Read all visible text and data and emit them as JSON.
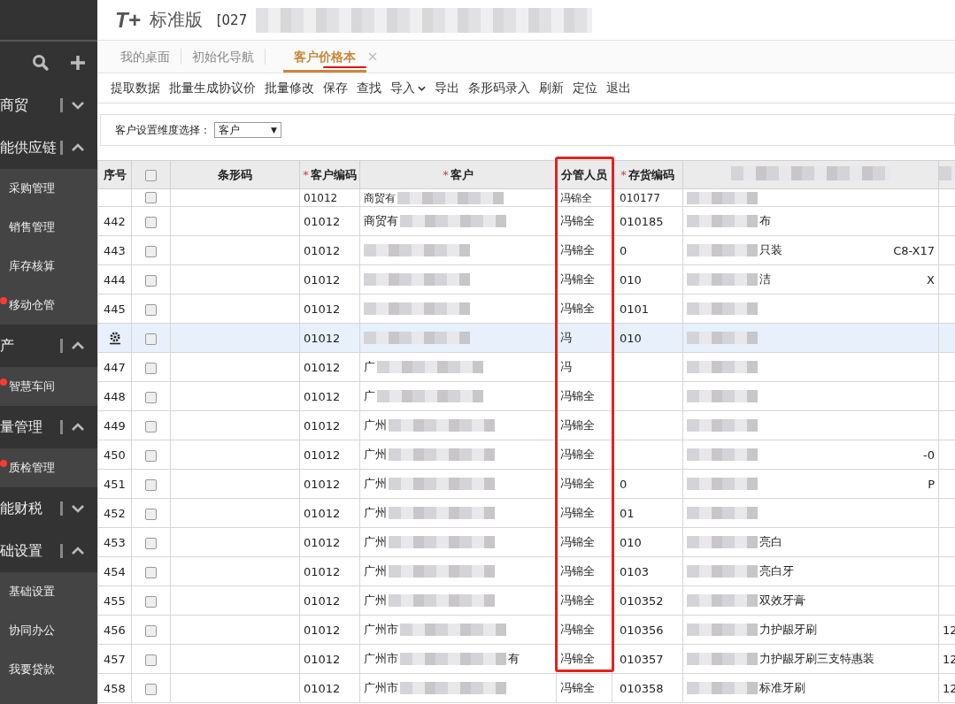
{
  "header": {
    "logo": "T+",
    "product": "标准版",
    "account": "[027"
  },
  "sidebar": {
    "groups": [
      {
        "label": "商贸",
        "expanded": false
      },
      {
        "label": "能供应链",
        "expanded": true,
        "items": [
          {
            "label": "采购管理",
            "alert": false
          },
          {
            "label": "销售管理",
            "alert": false
          },
          {
            "label": "库存核算",
            "alert": false
          },
          {
            "label": "移动仓管",
            "alert": true
          }
        ]
      },
      {
        "label": "产",
        "expanded": true,
        "items": [
          {
            "label": "智慧车间",
            "alert": true
          }
        ]
      },
      {
        "label": "量管理",
        "expanded": true,
        "items": [
          {
            "label": "质检管理",
            "alert": true
          }
        ]
      },
      {
        "label": "能财税",
        "expanded": false
      },
      {
        "label": "础设置",
        "expanded": true,
        "items": [
          {
            "label": "基础设置",
            "alert": false
          },
          {
            "label": "协同办公",
            "alert": false
          },
          {
            "label": "我要贷款",
            "alert": false
          }
        ]
      }
    ]
  },
  "tabs": [
    {
      "label": "我的桌面",
      "selected": false,
      "closable": false,
      "marked": false
    },
    {
      "label": "初始化导航",
      "selected": false,
      "closable": false,
      "marked": false
    },
    {
      "label": "客户价格本",
      "selected": true,
      "closable": true,
      "marked": true
    }
  ],
  "toolbar": [
    {
      "label": "提取数据",
      "kind": "button"
    },
    {
      "label": "批量生成协议价",
      "kind": "button"
    },
    {
      "label": "批量修改",
      "kind": "button"
    },
    {
      "label": "保存",
      "kind": "button"
    },
    {
      "label": "查找",
      "kind": "button"
    },
    {
      "label": "导入",
      "kind": "dropdown"
    },
    {
      "label": "导出",
      "kind": "button"
    },
    {
      "label": "条形码录入",
      "kind": "button"
    },
    {
      "label": "刷新",
      "kind": "button"
    },
    {
      "label": "定位",
      "kind": "button"
    },
    {
      "label": "退出",
      "kind": "button"
    }
  ],
  "filter": {
    "label": "客户设置维度选择：",
    "value": "客户",
    "arrow": "▼"
  },
  "table": {
    "header_checked": false,
    "columns": [
      {
        "label": "序号",
        "kind": "text",
        "highlighted": false
      },
      {
        "kind": "checkbox",
        "highlighted": false
      },
      {
        "label": "条形码",
        "kind": "text",
        "highlighted": false
      },
      {
        "mark": "*",
        "label": "客户编码",
        "kind": "text",
        "highlighted": false
      },
      {
        "mark": "*",
        "label": "客户",
        "kind": "text",
        "highlighted": false
      },
      {
        "label": "分管人员",
        "kind": "text",
        "highlighted": true
      },
      {
        "mark": "*",
        "label": "存货编码",
        "kind": "text",
        "highlighted": false
      },
      {
        "kind": "blank",
        "highlighted": false
      },
      {
        "kind": "blank",
        "highlighted": false
      }
    ],
    "rows": [
      {
        "kind": "partial",
        "checked": false,
        "selected": false,
        "customer_code": "01012",
        "customer": "商贸有",
        "staff": "冯锦全",
        "inventory_code": "010177"
      },
      {
        "kind": "numbered",
        "index": "442",
        "checked": false,
        "selected": false,
        "customer_code": "01012",
        "customer": "商贸有",
        "staff": "冯锦全",
        "inventory_code": "010185",
        "product": "布"
      },
      {
        "kind": "numbered",
        "index": "443",
        "checked": false,
        "selected": false,
        "customer_code": "01012",
        "staff": "冯锦全",
        "inventory_code": "0",
        "product": "只装",
        "product_tail": "C8-X17"
      },
      {
        "kind": "numbered",
        "index": "444",
        "checked": false,
        "selected": false,
        "customer_code": "01012",
        "staff": "冯锦全",
        "inventory_code": "010",
        "product": "洁",
        "product_tail": "X"
      },
      {
        "kind": "numbered",
        "index": "445",
        "checked": false,
        "selected": false,
        "customer_code": "01012",
        "staff": "冯锦全",
        "inventory_code": "0101"
      },
      {
        "kind": "editing",
        "checked": false,
        "selected": true,
        "customer_code": "01012",
        "staff": "冯",
        "inventory_code": "010"
      },
      {
        "kind": "numbered",
        "index": "447",
        "checked": false,
        "selected": false,
        "customer_code": "01012",
        "customer": "广",
        "staff": "冯"
      },
      {
        "kind": "numbered",
        "index": "448",
        "checked": false,
        "selected": false,
        "customer_code": "01012",
        "customer": "广",
        "staff": "冯锦全"
      },
      {
        "kind": "numbered",
        "index": "449",
        "checked": false,
        "selected": false,
        "customer_code": "01012",
        "customer": "广州",
        "staff": "冯锦全"
      },
      {
        "kind": "numbered",
        "index": "450",
        "checked": false,
        "selected": false,
        "customer_code": "01012",
        "customer": "广州",
        "staff": "冯锦全",
        "product_tail": "-0"
      },
      {
        "kind": "numbered",
        "index": "451",
        "checked": false,
        "selected": false,
        "customer_code": "01012",
        "customer": "广州",
        "staff": "冯锦全",
        "inventory_code": "0",
        "product_tail": "P"
      },
      {
        "kind": "numbered",
        "index": "452",
        "checked": false,
        "selected": false,
        "customer_code": "01012",
        "customer": "广州",
        "staff": "冯锦全",
        "inventory_code": "01"
      },
      {
        "kind": "numbered",
        "index": "453",
        "checked": false,
        "selected": false,
        "customer_code": "01012",
        "customer": "广州",
        "staff": "冯锦全",
        "inventory_code": "010",
        "product": "亮白"
      },
      {
        "kind": "numbered",
        "index": "454",
        "checked": false,
        "selected": false,
        "customer_code": "01012",
        "customer": "广州",
        "staff": "冯锦全",
        "inventory_code": "0103",
        "product": "亮白牙"
      },
      {
        "kind": "numbered",
        "index": "455",
        "checked": false,
        "selected": false,
        "customer_code": "01012",
        "customer": "广州",
        "staff": "冯锦全",
        "inventory_code": "010352",
        "product": "双效牙膏"
      },
      {
        "kind": "numbered",
        "index": "456",
        "checked": false,
        "selected": false,
        "customer_code": "01012",
        "customer": "广州市",
        "staff": "冯锦全",
        "inventory_code": "010356",
        "product": "力护龈牙刷",
        "extra": "12"
      },
      {
        "kind": "numbered",
        "index": "457",
        "checked": false,
        "selected": false,
        "customer_code": "01012",
        "customer": "广州市",
        "customer_tail": "有",
        "staff": "冯锦全",
        "inventory_code": "010357",
        "product": "力护龈牙刷三支特惠装",
        "extra": "12"
      },
      {
        "kind": "numbered",
        "index": "458",
        "checked": false,
        "selected": false,
        "customer_code": "01012",
        "customer": "广州市",
        "staff": "冯锦全",
        "inventory_code": "010358",
        "product": "标准牙刷",
        "extra": "12"
      }
    ]
  }
}
